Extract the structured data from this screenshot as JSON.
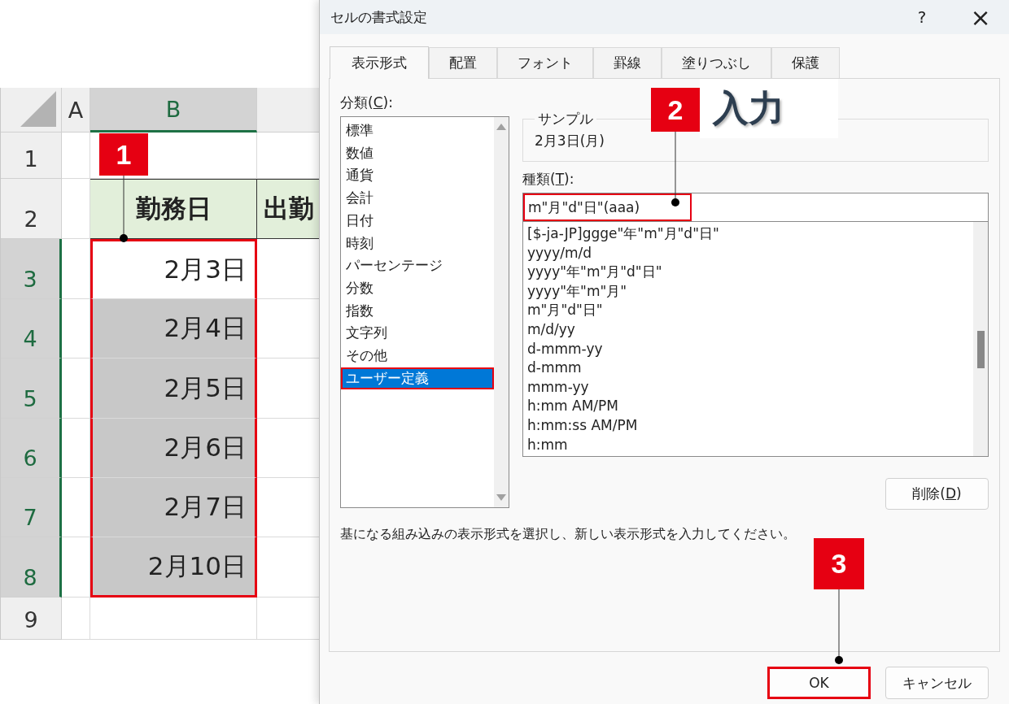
{
  "spreadsheet": {
    "columns": [
      {
        "label": "A",
        "selected": false
      },
      {
        "label": "B",
        "selected": true
      },
      {
        "selected": false
      }
    ],
    "rows": [
      {
        "label": "1",
        "kind": "blank",
        "selected": false
      },
      {
        "label": "2",
        "kind": "header",
        "selected": false,
        "cells": [
          "勤務日",
          "出勤"
        ]
      },
      {
        "label": "3",
        "kind": "data",
        "selected": true,
        "active": true,
        "cells": [
          "2月3日"
        ]
      },
      {
        "label": "4",
        "kind": "data",
        "selected": true,
        "active": false,
        "cells": [
          "2月4日"
        ]
      },
      {
        "label": "5",
        "kind": "data",
        "selected": true,
        "active": false,
        "cells": [
          "2月5日"
        ]
      },
      {
        "label": "6",
        "kind": "data",
        "selected": true,
        "active": false,
        "cells": [
          "2月6日"
        ]
      },
      {
        "label": "7",
        "kind": "data",
        "selected": true,
        "active": false,
        "cells": [
          "2月7日"
        ]
      },
      {
        "label": "8",
        "kind": "data",
        "selected": true,
        "active": false,
        "cells": [
          "2月10日"
        ]
      },
      {
        "label": "9",
        "kind": "blank",
        "selected": false
      }
    ]
  },
  "dialog": {
    "title": "セルの書式設定",
    "help": "?",
    "close": "×",
    "tabs": [
      {
        "label": "表示形式",
        "selected": true
      },
      {
        "label": "配置",
        "selected": false
      },
      {
        "label": "フォント",
        "selected": false
      },
      {
        "label": "罫線",
        "selected": false
      },
      {
        "label": "塗りつぶし",
        "selected": false
      },
      {
        "label": "保護",
        "selected": false
      }
    ],
    "category": {
      "label_parts": [
        "分類(",
        "C",
        "):"
      ],
      "items": [
        {
          "label": "標準",
          "selected": false
        },
        {
          "label": "数値",
          "selected": false
        },
        {
          "label": "通貨",
          "selected": false
        },
        {
          "label": "会計",
          "selected": false
        },
        {
          "label": "日付",
          "selected": false
        },
        {
          "label": "時刻",
          "selected": false
        },
        {
          "label": "パーセンテージ",
          "selected": false
        },
        {
          "label": "分数",
          "selected": false
        },
        {
          "label": "指数",
          "selected": false
        },
        {
          "label": "文字列",
          "selected": false
        },
        {
          "label": "その他",
          "selected": false
        },
        {
          "label": "ユーザー定義",
          "selected": true
        }
      ]
    },
    "sample": {
      "legend": "サンプル",
      "value": "2月3日(月)"
    },
    "type": {
      "label_parts": [
        "種類(",
        "T",
        "):"
      ],
      "value": "m\"月\"d\"日\"(aaa)",
      "highlighted": true
    },
    "formats": [
      "[$-ja-JP]ggge\"年\"m\"月\"d\"日\"",
      "yyyy/m/d",
      "yyyy\"年\"m\"月\"d\"日\"",
      "yyyy\"年\"m\"月\"",
      "m\"月\"d\"日\"",
      "m/d/yy",
      "d-mmm-yy",
      "d-mmm",
      "mmm-yy",
      "h:mm AM/PM",
      "h:mm:ss AM/PM",
      "h:mm"
    ],
    "delete_button": {
      "label_parts": [
        "削除(",
        "D",
        ")"
      ]
    },
    "description": "基になる組み込みの表示形式を選択し、新しい表示形式を入力してください。",
    "buttons": [
      {
        "label": "OK",
        "highlighted": true
      },
      {
        "label": "キャンセル",
        "highlighted": false
      }
    ]
  },
  "callouts": [
    {
      "number": "1"
    },
    {
      "number": "2",
      "label": "入力"
    },
    {
      "number": "3"
    }
  ]
}
